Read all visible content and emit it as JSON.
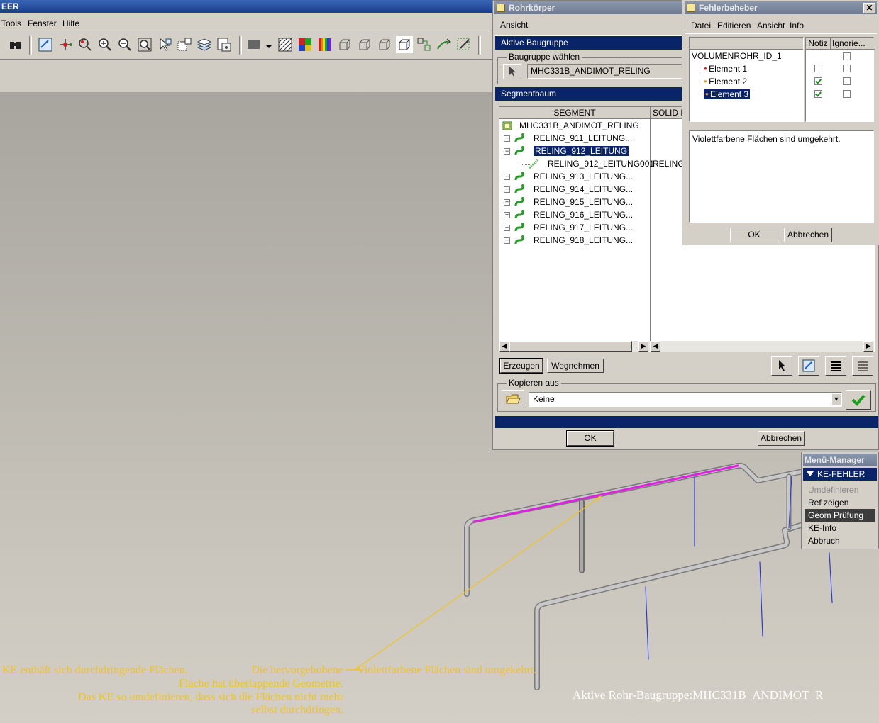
{
  "app": {
    "title": "EER",
    "menu": [
      "Tools",
      "Fenster",
      "Hilfe"
    ]
  },
  "rohrkoerper": {
    "title": "Rohrkörper",
    "menu_label": "Ansicht",
    "active_group_header": "Aktive Baugruppe",
    "select_group_label": "Baugruppe wählen",
    "group_value": "MHC331B_ANDIMOT_RELING",
    "segment_tree_header": "Segmentbaum",
    "columns": [
      "SEGMENT",
      "SOLID N"
    ],
    "tree": [
      {
        "label": "MHC331B_ANDIMOT_RELING",
        "level": 0
      },
      {
        "label": "RELING_911_LEITUNG...",
        "level": 1,
        "expander": "+"
      },
      {
        "label": "RELING_912_LEITUNG",
        "level": 1,
        "expander": "-",
        "selected": true
      },
      {
        "label": "RELING_912_LEITUNG001",
        "level": 2,
        "solid": "RELING_"
      },
      {
        "label": "RELING_913_LEITUNG...",
        "level": 1,
        "expander": "+"
      },
      {
        "label": "RELING_914_LEITUNG...",
        "level": 1,
        "expander": "+"
      },
      {
        "label": "RELING_915_LEITUNG...",
        "level": 1,
        "expander": "+"
      },
      {
        "label": "RELING_916_LEITUNG...",
        "level": 1,
        "expander": "+"
      },
      {
        "label": "RELING_917_LEITUNG...",
        "level": 1,
        "expander": "+"
      },
      {
        "label": "RELING_918_LEITUNG...",
        "level": 1,
        "expander": "+"
      }
    ],
    "create_button": "Erzeugen",
    "remove_button": "Wegnehmen",
    "copy_from_label": "Kopieren aus",
    "copy_value": "Keine",
    "ok_button": "OK",
    "cancel_button": "Abbrechen"
  },
  "fehlerbeheber": {
    "title": "Fehlerbeheber",
    "menu": [
      "Datei",
      "Editieren",
      "Ansicht",
      "Info"
    ],
    "columns": [
      "Notiz",
      "Ignorie..."
    ],
    "root": "VOLUMENROHR_ID_1",
    "items": [
      {
        "label": "Element 1",
        "dot": "#d02020",
        "notiz": false,
        "ignore": false
      },
      {
        "label": "Element 2",
        "dot": "#f0a020",
        "notiz": true,
        "ignore": false
      },
      {
        "label": "Element 3",
        "dot": "#f0a020",
        "notiz": true,
        "ignore": false,
        "selected": true
      }
    ],
    "message": "Violettfarbene Flächen sind umgekehrt.",
    "ok_button": "OK",
    "cancel_button": "Abbrechen"
  },
  "menu_manager": {
    "title": "Menü-Manager",
    "header": "KE-FEHLER",
    "items": [
      {
        "label": "Umdefinieren",
        "disabled": true
      },
      {
        "label": "Ref zeigen"
      },
      {
        "label": "Geom Prüfung",
        "highlighted": true
      },
      {
        "label": "KE-Info"
      },
      {
        "label": "Abbruch"
      }
    ]
  },
  "annotations": {
    "left_lines": [
      "KE enthält sich durchdringende Flächen.",
      "Das KE so umdefinieren, dass sich die Flächen nicht mehr",
      "selbst durchdringen."
    ],
    "middle_lines": [
      "Die hervorgehobene",
      "Fläche hat überlappende Geometrie."
    ],
    "right": "Violettfarbene Flächen sind umgekehrt.",
    "status": "Aktive Rohr-Baugruppe:MHC331B_ANDIMOT_R"
  },
  "colors": {
    "title_active": "#173e8b",
    "selection": "#0a246a",
    "annotation": "#f0c41d",
    "highlight_pipe": "#e020e0"
  }
}
